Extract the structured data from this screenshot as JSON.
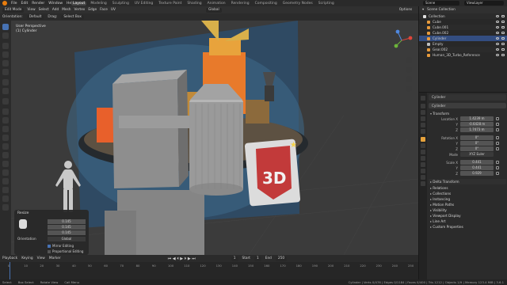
{
  "top_menu": {
    "items": [
      "File",
      "Edit",
      "Render",
      "Window",
      "Help"
    ],
    "workspaces": [
      "Layout",
      "Modeling",
      "Sculpting",
      "UV Editing",
      "Texture Paint",
      "Shading",
      "Animation",
      "Rendering",
      "Compositing",
      "Geometry Nodes",
      "Scripting"
    ],
    "scene": "Scene",
    "view_layer": "ViewLayer"
  },
  "viewport_header": {
    "mode": "Edit Mode",
    "menus": [
      "View",
      "Select",
      "Add",
      "Mesh",
      "Vertex",
      "Edge",
      "Face",
      "UV"
    ],
    "orientation_label": "Orientation:",
    "orientation_value": "Default",
    "drag_label": "Drag:",
    "drag_value": "Select Box",
    "transform_orientation": "Global",
    "options_label": "Options"
  },
  "viewport": {
    "view_name": "User Perspective",
    "object_name": "(1) Cylinder",
    "badge_text": "3D"
  },
  "redo_panel": {
    "title": "Resize",
    "scale_values": [
      "0.145",
      "0.145",
      "0.145"
    ],
    "orientation_label": "Orientation",
    "orientation_value": "Global",
    "mirror_label": "Mirror Editing",
    "proportional_label": "Proportional Editing"
  },
  "timeline": {
    "menus": [
      "Playback",
      "Keying",
      "View",
      "Marker"
    ],
    "start_label": "Start",
    "start_value": "1",
    "end_label": "End",
    "end_value": "250",
    "current_frame": "1",
    "ticks": [
      "0",
      "10",
      "20",
      "30",
      "40",
      "50",
      "60",
      "70",
      "80",
      "90",
      "100",
      "110",
      "120",
      "130",
      "140",
      "150",
      "160",
      "170",
      "180",
      "190",
      "200",
      "210",
      "220",
      "230",
      "240",
      "250"
    ]
  },
  "status_bar": {
    "items": [
      "Select",
      "Box Select",
      "Rotate View",
      "Call Menu"
    ],
    "stats": "Cylinder | Verts 0/476 | Edges 0/1184 | Faces 0/400 | Tris 1212 | Objects 1/9 | Memory 123.4 MiB | 3.6.1"
  },
  "outliner": {
    "title": "Scene Collection",
    "rows": [
      {
        "label": "Collection",
        "indent": 1,
        "color": "#e0e0e0"
      },
      {
        "label": "Cube",
        "indent": 2,
        "color": "#e89b3c"
      },
      {
        "label": "Cube.001",
        "indent": 2,
        "color": "#e89b3c"
      },
      {
        "label": "Cube.002",
        "indent": 2,
        "color": "#e89b3c"
      },
      {
        "label": "Cylinder",
        "indent": 2,
        "color": "#e89b3c",
        "selected": true
      },
      {
        "label": "Empty",
        "indent": 2,
        "color": "#c0c0c0"
      },
      {
        "label": "Gear.002",
        "indent": 2,
        "color": "#e89b3c"
      },
      {
        "label": "Human_3D_Turbo_Reference",
        "indent": 2,
        "color": "#e89b3c"
      }
    ]
  },
  "properties": {
    "header": "Cylinder",
    "object_name": "Cylinder",
    "transform_label": "Transform",
    "location_label": "Location X",
    "location": [
      "1.4239 m",
      "-0.6428 m",
      "1.7473 m"
    ],
    "rotation_label": "Rotation X",
    "rotation": [
      "0°",
      "0°",
      "0°"
    ],
    "mode_label": "Mode",
    "mode_value": "XYZ Euler",
    "scale_label": "Scale X",
    "scale": [
      "0.441",
      "0.441",
      "0.929"
    ],
    "axis_labels": [
      "Y",
      "Z"
    ],
    "sections": [
      "Delta Transform",
      "Relations",
      "Collections",
      "Instancing",
      "Motion Paths",
      "Visibility",
      "Viewport Display",
      "Line Art",
      "Custom Properties"
    ]
  },
  "colors": {
    "accent": "#4772b3",
    "selection": "#e89b3c",
    "background": "#1d1d1d"
  }
}
